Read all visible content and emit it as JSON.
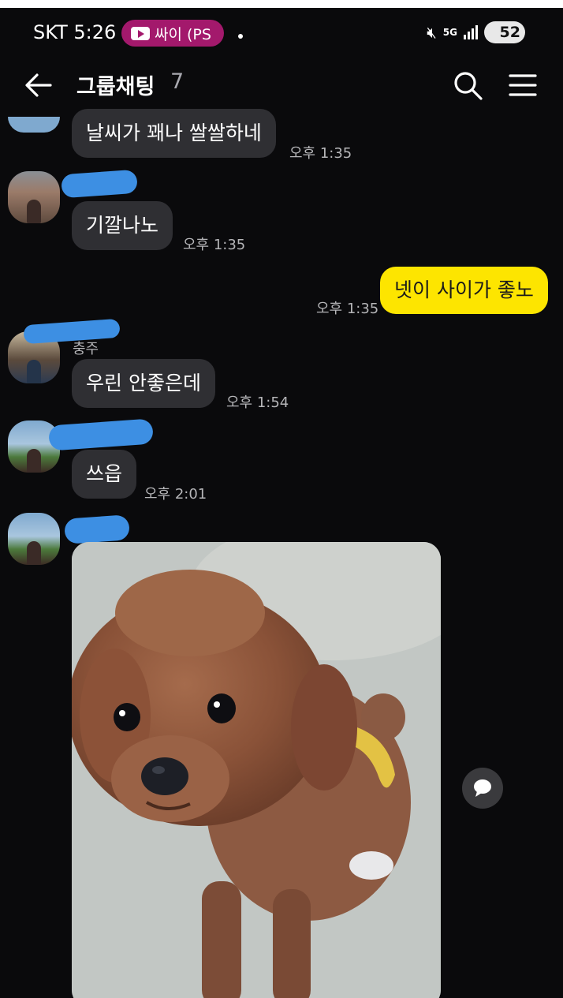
{
  "status_bar": {
    "carrier_time": "SKT 5:26",
    "media_pill": "싸이 (PS",
    "network": "5G",
    "battery": "52",
    "accent": "#a3196c"
  },
  "header": {
    "title": "그룹채팅",
    "member_count": "7"
  },
  "messages": [
    {
      "text": "날씨가 꽤나 쌀쌀하네",
      "time": "오후 1:35",
      "sender": "other"
    },
    {
      "text": "기깔나노",
      "time": "오후 1:35",
      "sender": "other"
    },
    {
      "text": "넷이 사이가 좋노",
      "time": "오후 1:35",
      "sender": "me"
    },
    {
      "name_fragment": "충주",
      "text": "우린 안좋은데",
      "time": "오후 1:54",
      "sender": "other"
    },
    {
      "text": "쓰읍",
      "time": "오후 2:01",
      "sender": "other"
    },
    {
      "type": "photo",
      "sender": "other"
    }
  ],
  "colors": {
    "background": "#0a0a0c",
    "bubble_other": "#2f2f33",
    "bubble_mine": "#fde500",
    "redaction": "#3d8fe3"
  }
}
